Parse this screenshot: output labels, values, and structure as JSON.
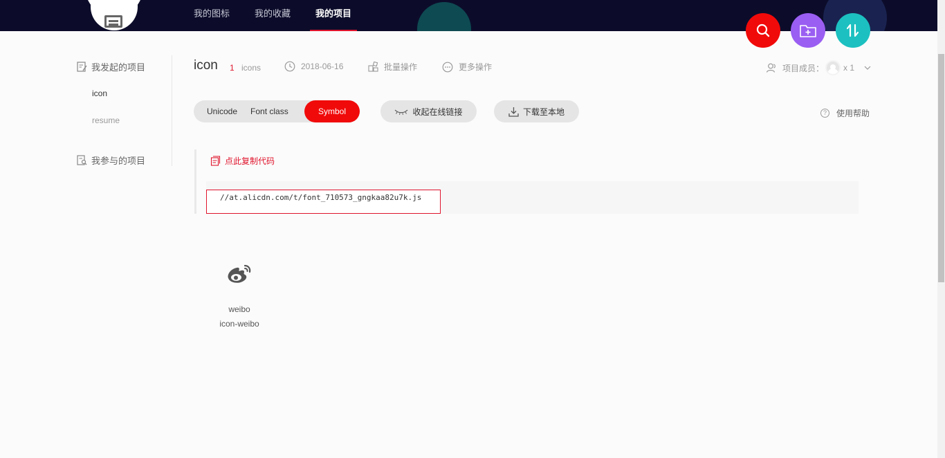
{
  "nav": {
    "items": [
      "我的图标",
      "我的收藏",
      "我的项目"
    ],
    "active_index": 2
  },
  "actions": {
    "search": "search-icon",
    "add_folder": "add-folder-icon",
    "sort": "sort-icon"
  },
  "sidebar": {
    "initiated_heading": "我发起的项目",
    "initiated_projects": [
      "icon",
      "resume"
    ],
    "joined_heading": "我参与的项目"
  },
  "project": {
    "title": "icon",
    "count": "1",
    "count_unit": "icons",
    "date": "2018-06-16",
    "batch_ops": "批量操作",
    "more_ops": "更多操作",
    "members_label": "项目成员：",
    "members_count": "x 1"
  },
  "tabs": [
    "Unicode",
    "Font class",
    "Symbol"
  ],
  "buttons": {
    "collapse_online": "收起在线链接",
    "download_local": "下载至本地",
    "help": "使用帮助",
    "copy_code": "点此复制代码"
  },
  "code_url": "//at.alicdn.com/t/font_710573_gngkaa82u7k.js",
  "icons": [
    {
      "name": "weibo",
      "code": "icon-weibo"
    }
  ],
  "colors": {
    "header_bg": "#0c0c2a",
    "accent_red": "#f10a0a",
    "purple": "#9a5ef2",
    "teal": "#1cc0c0"
  }
}
